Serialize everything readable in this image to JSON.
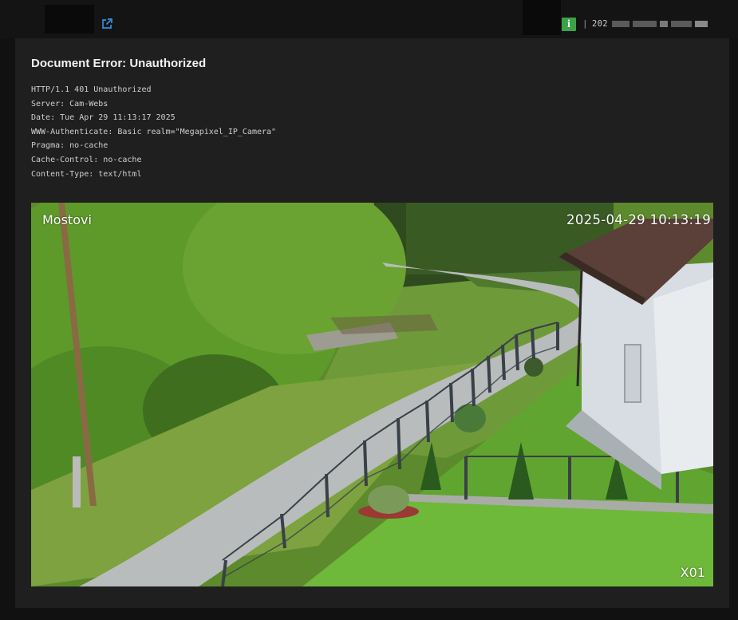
{
  "header": {
    "link_icon": "external-link-icon",
    "info_icon": "info-icon",
    "info_glyph": "i",
    "separator": "|",
    "timestamp_visible": "202",
    "colors": {
      "info": "#3aa348",
      "link": "#2f8fe0"
    }
  },
  "error": {
    "title": "Document Error: Unauthorized",
    "headers": [
      "HTTP/1.1 401 Unauthorized",
      "Server: Cam-Webs",
      "Date: Tue Apr 29 11:13:17 2025",
      "WWW-Authenticate: Basic realm=\"Megapixel_IP_Camera\"",
      "Pragma: no-cache",
      "Cache-Control: no-cache",
      "Content-Type: text/html"
    ]
  },
  "camera": {
    "name": "Mostovi",
    "datetime": "2025-04-29  10:13:19",
    "channel": "X01"
  }
}
